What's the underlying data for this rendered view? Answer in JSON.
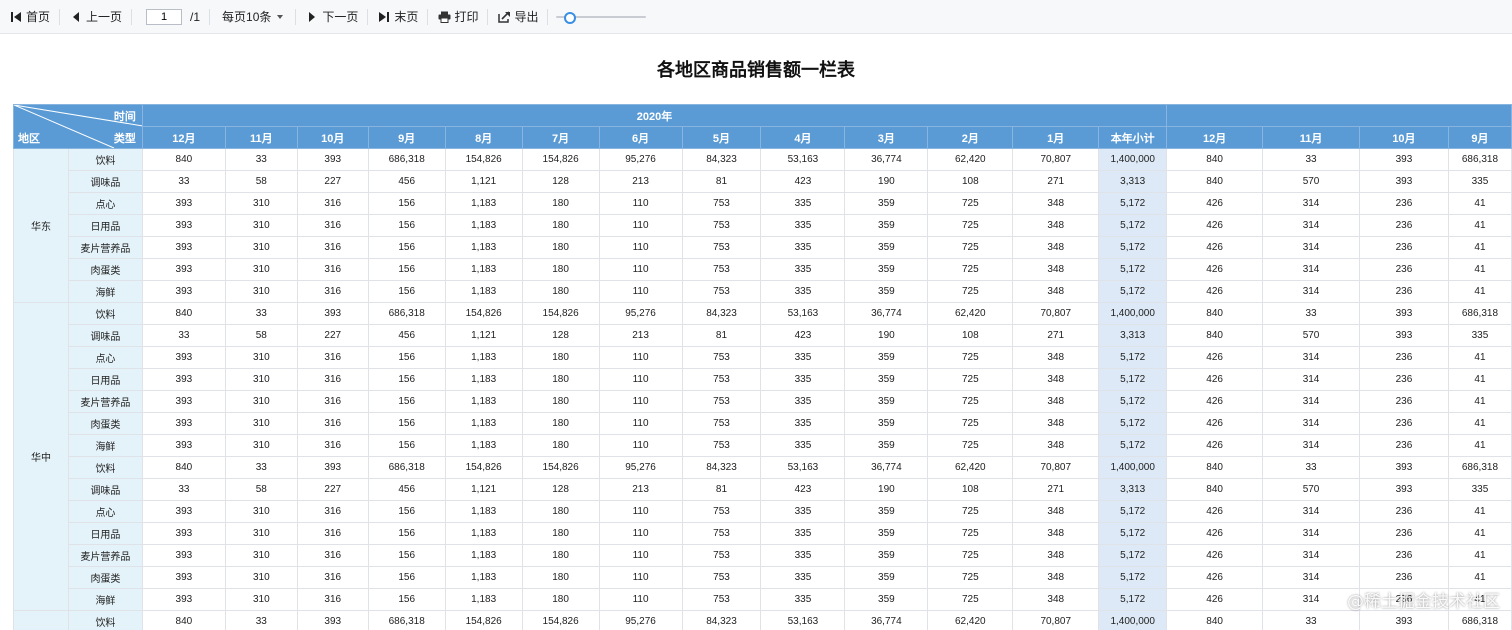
{
  "toolbar": {
    "first_label": "首页",
    "prev_label": "上一页",
    "page_value": "1",
    "page_total": "/1",
    "page_size_label": "每页10条",
    "next_label": "下一页",
    "last_label": "末页",
    "print_label": "打印",
    "export_label": "导出",
    "zoom_level": 0.1
  },
  "report": {
    "title": "各地区商品销售额一栏表",
    "corner_time": "时间",
    "corner_type": "类型",
    "corner_region": "地区",
    "year_2020": "2020年",
    "months": [
      "12月",
      "11月",
      "10月",
      "9月",
      "8月",
      "7月",
      "6月",
      "5月",
      "4月",
      "3月",
      "2月",
      "1月"
    ],
    "subtotal_label": "本年小计",
    "months_next": [
      "12月",
      "11月",
      "10月",
      "9月"
    ]
  },
  "colors": {
    "header": "#5b9bd5",
    "row_header": "#e4f2f9",
    "subtotal": "#dde9f6"
  },
  "table": {
    "groups": [
      {
        "region": "华东",
        "rows": [
          {
            "type": "饮料",
            "values": [
              "840",
              "33",
              "393",
              "686,318",
              "154,826",
              "154,826",
              "95,276",
              "84,323",
              "53,163",
              "36,774",
              "62,420",
              "70,807"
            ],
            "subtotal": "1,400,000",
            "next": [
              "840",
              "33",
              "393",
              "686,318"
            ]
          },
          {
            "type": "调味品",
            "values": [
              "33",
              "58",
              "227",
              "456",
              "1,121",
              "128",
              "213",
              "81",
              "423",
              "190",
              "108",
              "271"
            ],
            "subtotal": "3,313",
            "next": [
              "840",
              "570",
              "393",
              "335"
            ]
          },
          {
            "type": "点心",
            "values": [
              "393",
              "310",
              "316",
              "156",
              "1,183",
              "180",
              "110",
              "753",
              "335",
              "359",
              "725",
              "348"
            ],
            "subtotal": "5,172",
            "next": [
              "426",
              "314",
              "236",
              "41"
            ]
          },
          {
            "type": "日用品",
            "values": [
              "393",
              "310",
              "316",
              "156",
              "1,183",
              "180",
              "110",
              "753",
              "335",
              "359",
              "725",
              "348"
            ],
            "subtotal": "5,172",
            "next": [
              "426",
              "314",
              "236",
              "41"
            ]
          },
          {
            "type": "麦片营养品",
            "values": [
              "393",
              "310",
              "316",
              "156",
              "1,183",
              "180",
              "110",
              "753",
              "335",
              "359",
              "725",
              "348"
            ],
            "subtotal": "5,172",
            "next": [
              "426",
              "314",
              "236",
              "41"
            ]
          },
          {
            "type": "肉蛋类",
            "values": [
              "393",
              "310",
              "316",
              "156",
              "1,183",
              "180",
              "110",
              "753",
              "335",
              "359",
              "725",
              "348"
            ],
            "subtotal": "5,172",
            "next": [
              "426",
              "314",
              "236",
              "41"
            ]
          },
          {
            "type": "海鲜",
            "values": [
              "393",
              "310",
              "316",
              "156",
              "1,183",
              "180",
              "110",
              "753",
              "335",
              "359",
              "725",
              "348"
            ],
            "subtotal": "5,172",
            "next": [
              "426",
              "314",
              "236",
              "41"
            ]
          }
        ]
      },
      {
        "region": "华中",
        "rows": [
          {
            "type": "饮料",
            "values": [
              "840",
              "33",
              "393",
              "686,318",
              "154,826",
              "154,826",
              "95,276",
              "84,323",
              "53,163",
              "36,774",
              "62,420",
              "70,807"
            ],
            "subtotal": "1,400,000",
            "next": [
              "840",
              "33",
              "393",
              "686,318"
            ]
          },
          {
            "type": "调味品",
            "values": [
              "33",
              "58",
              "227",
              "456",
              "1,121",
              "128",
              "213",
              "81",
              "423",
              "190",
              "108",
              "271"
            ],
            "subtotal": "3,313",
            "next": [
              "840",
              "570",
              "393",
              "335"
            ]
          },
          {
            "type": "点心",
            "values": [
              "393",
              "310",
              "316",
              "156",
              "1,183",
              "180",
              "110",
              "753",
              "335",
              "359",
              "725",
              "348"
            ],
            "subtotal": "5,172",
            "next": [
              "426",
              "314",
              "236",
              "41"
            ]
          },
          {
            "type": "日用品",
            "values": [
              "393",
              "310",
              "316",
              "156",
              "1,183",
              "180",
              "110",
              "753",
              "335",
              "359",
              "725",
              "348"
            ],
            "subtotal": "5,172",
            "next": [
              "426",
              "314",
              "236",
              "41"
            ]
          },
          {
            "type": "麦片营养品",
            "values": [
              "393",
              "310",
              "316",
              "156",
              "1,183",
              "180",
              "110",
              "753",
              "335",
              "359",
              "725",
              "348"
            ],
            "subtotal": "5,172",
            "next": [
              "426",
              "314",
              "236",
              "41"
            ]
          },
          {
            "type": "肉蛋类",
            "values": [
              "393",
              "310",
              "316",
              "156",
              "1,183",
              "180",
              "110",
              "753",
              "335",
              "359",
              "725",
              "348"
            ],
            "subtotal": "5,172",
            "next": [
              "426",
              "314",
              "236",
              "41"
            ]
          },
          {
            "type": "海鲜",
            "values": [
              "393",
              "310",
              "316",
              "156",
              "1,183",
              "180",
              "110",
              "753",
              "335",
              "359",
              "725",
              "348"
            ],
            "subtotal": "5,172",
            "next": [
              "426",
              "314",
              "236",
              "41"
            ]
          },
          {
            "type": "饮料",
            "values": [
              "840",
              "33",
              "393",
              "686,318",
              "154,826",
              "154,826",
              "95,276",
              "84,323",
              "53,163",
              "36,774",
              "62,420",
              "70,807"
            ],
            "subtotal": "1,400,000",
            "next": [
              "840",
              "33",
              "393",
              "686,318"
            ]
          },
          {
            "type": "调味品",
            "values": [
              "33",
              "58",
              "227",
              "456",
              "1,121",
              "128",
              "213",
              "81",
              "423",
              "190",
              "108",
              "271"
            ],
            "subtotal": "3,313",
            "next": [
              "840",
              "570",
              "393",
              "335"
            ]
          },
          {
            "type": "点心",
            "values": [
              "393",
              "310",
              "316",
              "156",
              "1,183",
              "180",
              "110",
              "753",
              "335",
              "359",
              "725",
              "348"
            ],
            "subtotal": "5,172",
            "next": [
              "426",
              "314",
              "236",
              "41"
            ]
          },
          {
            "type": "日用品",
            "values": [
              "393",
              "310",
              "316",
              "156",
              "1,183",
              "180",
              "110",
              "753",
              "335",
              "359",
              "725",
              "348"
            ],
            "subtotal": "5,172",
            "next": [
              "426",
              "314",
              "236",
              "41"
            ]
          },
          {
            "type": "麦片营养品",
            "values": [
              "393",
              "310",
              "316",
              "156",
              "1,183",
              "180",
              "110",
              "753",
              "335",
              "359",
              "725",
              "348"
            ],
            "subtotal": "5,172",
            "next": [
              "426",
              "314",
              "236",
              "41"
            ]
          },
          {
            "type": "肉蛋类",
            "values": [
              "393",
              "310",
              "316",
              "156",
              "1,183",
              "180",
              "110",
              "753",
              "335",
              "359",
              "725",
              "348"
            ],
            "subtotal": "5,172",
            "next": [
              "426",
              "314",
              "236",
              "41"
            ]
          },
          {
            "type": "海鲜",
            "values": [
              "393",
              "310",
              "316",
              "156",
              "1,183",
              "180",
              "110",
              "753",
              "335",
              "359",
              "725",
              "348"
            ],
            "subtotal": "5,172",
            "next": [
              "426",
              "314",
              "236",
              "41"
            ]
          }
        ]
      },
      {
        "region": "",
        "rows": [
          {
            "type": "饮料",
            "values": [
              "840",
              "33",
              "393",
              "686,318",
              "154,826",
              "154,826",
              "95,276",
              "84,323",
              "53,163",
              "36,774",
              "62,420",
              "70,807"
            ],
            "subtotal": "1,400,000",
            "next": [
              "840",
              "33",
              "393",
              "686,318"
            ]
          }
        ]
      }
    ]
  },
  "watermark": "@稀土掘金技术社区"
}
